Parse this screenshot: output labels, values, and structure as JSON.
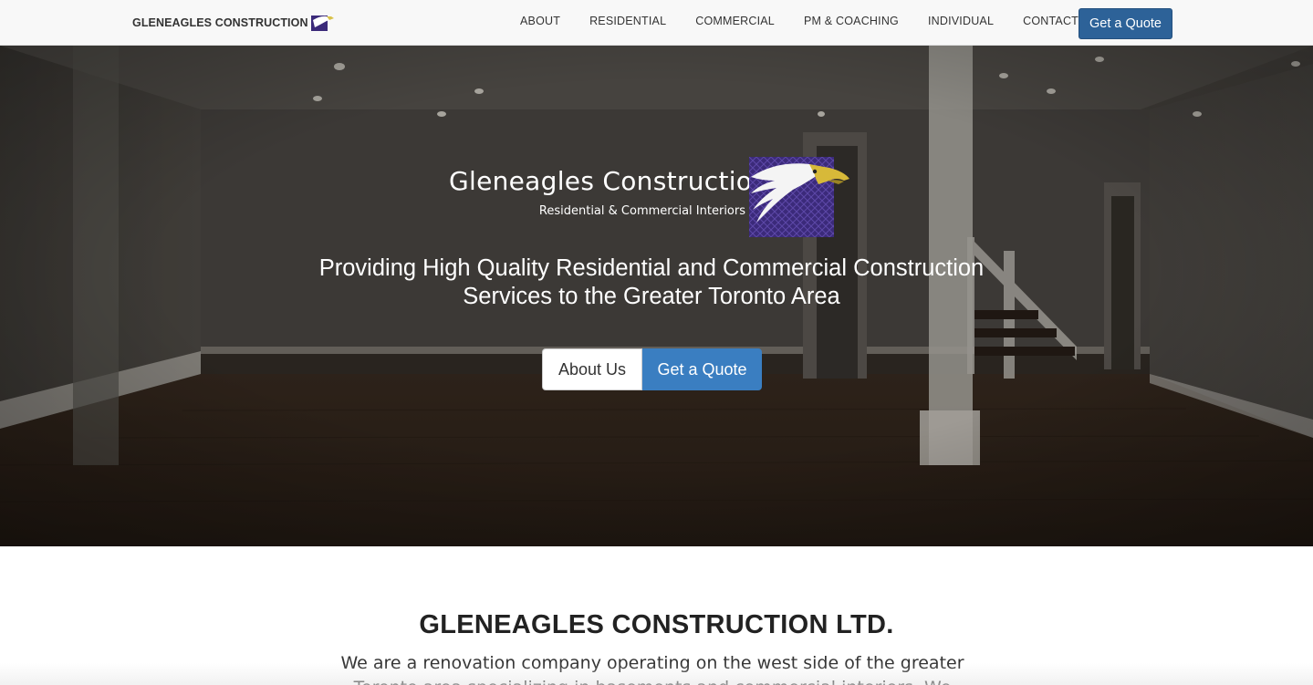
{
  "navbar": {
    "brand_text": "GLENEAGLES CONSTRUCTION",
    "brand_icon": "eagle-logo-icon",
    "links": [
      "ABOUT",
      "RESIDENTIAL",
      "COMMERCIAL",
      "PM & COACHING",
      "INDIVIDUAL",
      "CONTACT"
    ],
    "cta_label": "Get a Quote"
  },
  "hero": {
    "logo_name": "Gleneagles Construction",
    "logo_subtitle": "Residential & Commercial Interiors",
    "tagline_line1": "Providing High Quality Residential and Commercial Construction",
    "tagline_line2": "Services to the Greater Toronto Area",
    "about_button": "About Us",
    "quote_button": "Get a Quote"
  },
  "about": {
    "heading": "GLENEAGLES CONSTRUCTION LTD.",
    "body": "We are a renovation company operating on the west side of the greater Toronto area specializing in basements and commercial interiors. We"
  },
  "colors": {
    "brand_blue": "#2d6298",
    "cta_blue": "#3a7ec1",
    "navbar_bg": "#f8f8f8",
    "logo_purple": "#3b2a7a"
  }
}
